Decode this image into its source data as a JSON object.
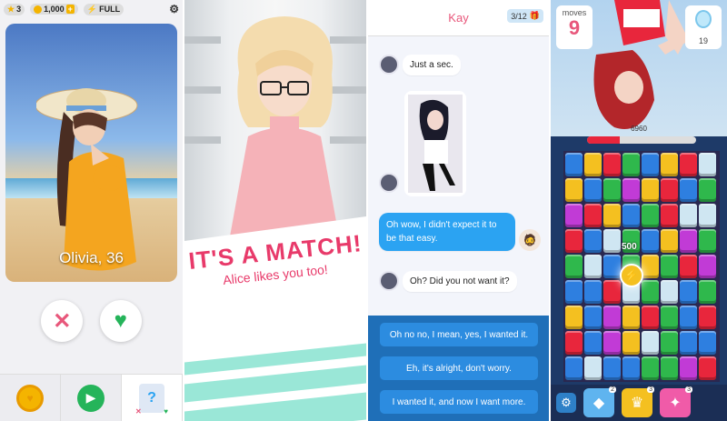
{
  "panel1": {
    "stars": "3",
    "coins": "1,000",
    "energy": "FULL",
    "profile_name": "Olivia, 36",
    "colors": {
      "reject": "#e8577b",
      "like": "#25b45a",
      "play": "#25b45a"
    }
  },
  "panel2": {
    "match_title": "IT'S A MATCH!",
    "match_sub": "Alice likes you too!"
  },
  "panel3": {
    "contact_name": "Kay",
    "gift_counter": "3/12",
    "messages": [
      {
        "from": "her",
        "text": "Just a sec."
      },
      {
        "from": "me",
        "text": "Oh wow, I didn't expect it to be that easy."
      },
      {
        "from": "her",
        "text": "Oh? Did you not want it?"
      }
    ],
    "replies": [
      "Oh no no, I mean, yes, I wanted it.",
      "Eh, it's alright, don't worry.",
      "I wanted it, and now I want more."
    ]
  },
  "panel4": {
    "moves_label": "moves",
    "moves": "9",
    "goal_count": "19",
    "score": "6960",
    "popup_score": "500",
    "progress": 0.3,
    "boosters": [
      "2",
      "3",
      "3"
    ]
  }
}
